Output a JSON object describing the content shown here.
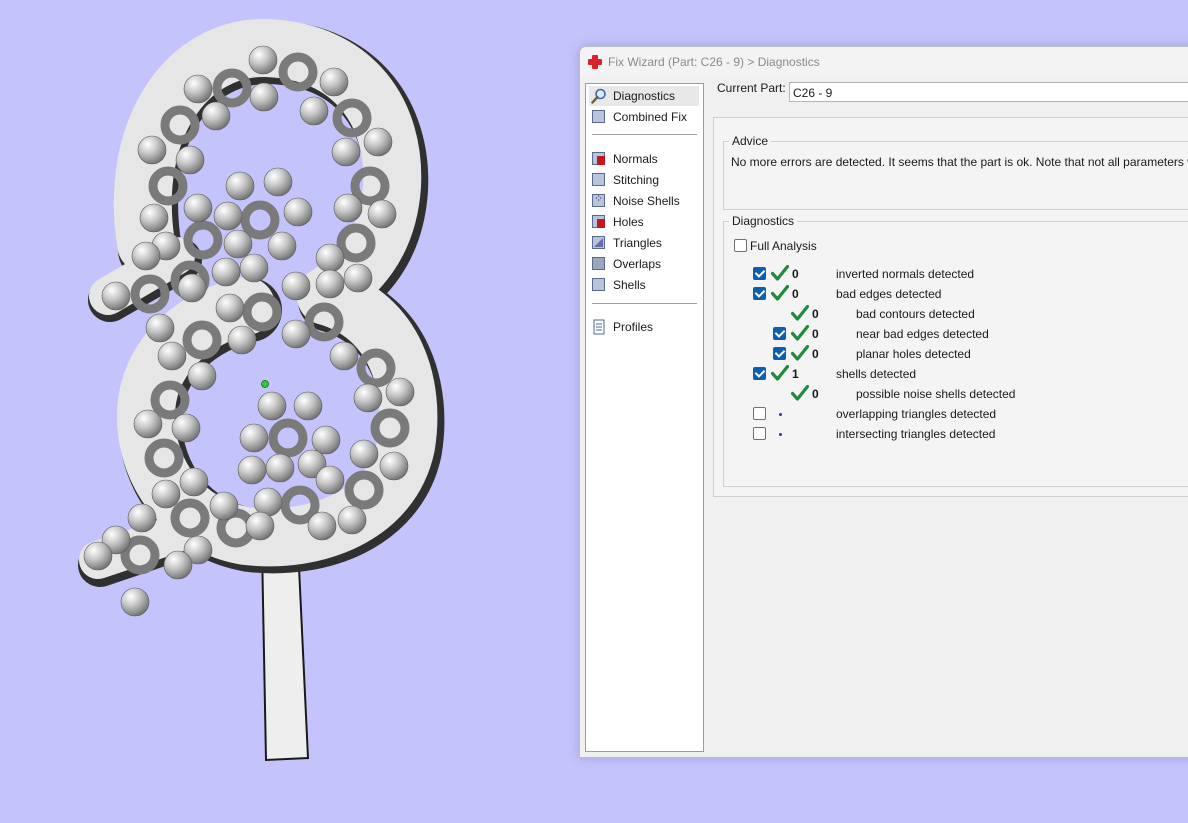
{
  "window": {
    "title": "Fix Wizard (Part: C26 - 9) > Diagnostics"
  },
  "nav": {
    "items": [
      {
        "label": "Diagnostics"
      },
      {
        "label": "Combined Fix"
      },
      {
        "label": "Normals"
      },
      {
        "label": "Stitching"
      },
      {
        "label": "Noise Shells"
      },
      {
        "label": "Holes"
      },
      {
        "label": "Triangles"
      },
      {
        "label": "Overlaps"
      },
      {
        "label": "Shells"
      },
      {
        "label": "Profiles"
      }
    ]
  },
  "current_part": {
    "label": "Current Part:",
    "value": "C26 - 9"
  },
  "advice": {
    "title": "Advice",
    "text": "No more errors are detected. It seems that the part is ok. Note that not all parameters were a"
  },
  "diagnostics": {
    "title": "Diagnostics",
    "full_analysis_label": "Full Analysis",
    "rows": [
      {
        "checked": true,
        "status": "ok",
        "count": "0",
        "label": "inverted normals detected"
      },
      {
        "checked": true,
        "status": "ok",
        "count": "0",
        "label": "bad edges detected"
      },
      {
        "checked": null,
        "status": "ok",
        "count": "0",
        "label": "bad contours detected"
      },
      {
        "checked": true,
        "status": "ok",
        "count": "0",
        "label": "near bad edges detected"
      },
      {
        "checked": true,
        "status": "ok",
        "count": "0",
        "label": "planar holes detected"
      },
      {
        "checked": true,
        "status": "ok",
        "count": "1",
        "label": "shells detected"
      },
      {
        "checked": null,
        "status": "ok",
        "count": "0",
        "label": "possible noise shells detected"
      },
      {
        "checked": false,
        "status": "none",
        "count": "",
        "label": "overlapping triangles detected"
      },
      {
        "checked": false,
        "status": "none",
        "count": "",
        "label": "intersecting triangles detected"
      }
    ]
  },
  "colors": {
    "background": "#c5c3fb",
    "check_green": "#1f8a3c",
    "checkbox_blue": "#0a5fb4"
  },
  "icons": {
    "app": "red-cross-icon",
    "diagnostics": "magnifier-icon",
    "combined_fix": "cube-icon",
    "normals": "normals-cube-icon",
    "stitching": "stitching-cube-icon",
    "noise_shells": "noise-shells-icon",
    "holes": "holes-cube-icon",
    "triangles": "triangles-cube-icon",
    "overlaps": "overlaps-cube-icon",
    "shells": "shells-cube-icon",
    "profiles": "document-icon",
    "check": "green-check-icon"
  }
}
